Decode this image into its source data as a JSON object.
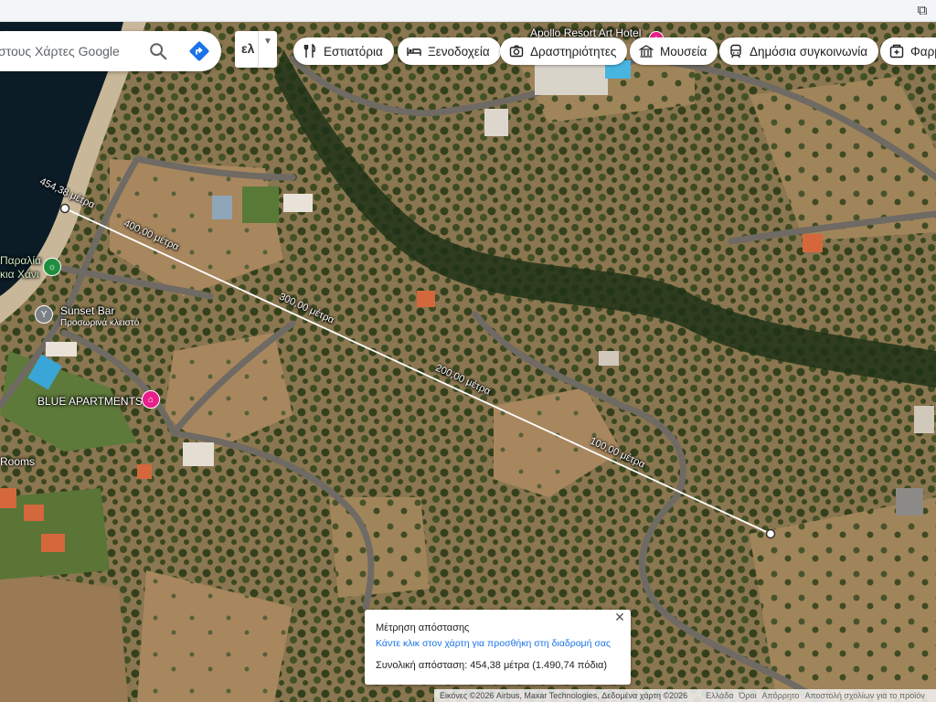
{
  "toolbar": {
    "extension_icon": "puzzle-icon"
  },
  "search": {
    "placeholder": "στους Χάρτες Google",
    "search_icon": "search-icon",
    "directions_icon": "directions-icon"
  },
  "language": {
    "label": "ελ",
    "dropdown_icon": "chevron-down-icon"
  },
  "chips": [
    {
      "label": "Εστιατόρια",
      "icon": "fork-knife-icon"
    },
    {
      "label": "Ξενοδοχεία",
      "icon": "bed-icon"
    },
    {
      "label": "Δραστηριότητες",
      "icon": "camera-icon"
    },
    {
      "label": "Μουσεία",
      "icon": "museum-icon"
    },
    {
      "label": "Δημόσια συγκοινωνία",
      "icon": "train-icon"
    },
    {
      "label": "Φαρμ",
      "icon": "pharmacy-icon"
    }
  ],
  "places": {
    "apollo": "Apollo Resort Art Hotel",
    "beach_line1": "Παραλία",
    "beach_line2": "κια Χάνι",
    "sunset_bar": "Sunset Bar",
    "sunset_bar_status": "Προσωρινά κλειστό",
    "blue_apartments": "BLUE APARTMENTS",
    "rooms": "Rooms"
  },
  "measure_labels": {
    "total_end": "454,38 μέτρα",
    "m400": "400,00 μέτρα",
    "m300": "300,00 μέτρα",
    "m200": "200,00 μέτρα",
    "m100": "100,00 μέτρα"
  },
  "panel": {
    "title": "Μέτρηση απόστασης",
    "hint": "Κάντε κλικ στον χάρτη για προσθήκη στη διαδρομή σας",
    "total": "Συνολική απόσταση: 454,38 μέτρα (1.490,74 πόδια)",
    "close_icon": "close-icon"
  },
  "footer": {
    "imagery": "Εικόνες ©2026 Airbus, Maxar Technologies, Δεδομένα χάρτη ©2026",
    "region": "Ελλάδα",
    "terms": "Όροι",
    "privacy": "Απόρρητο",
    "feedback": "Αποστολή σχολίων για το προϊόν"
  },
  "colors": {
    "pin_pink": "#e91e8c",
    "pin_green": "#1e8e3e",
    "link_blue": "#1a73e8"
  }
}
